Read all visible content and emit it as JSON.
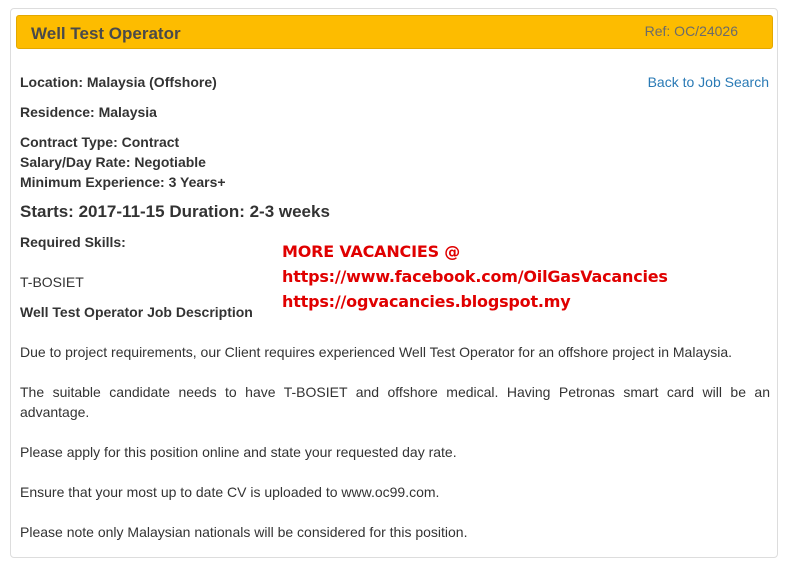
{
  "header": {
    "title": "Well Test Operator",
    "ref": "Ref: OC/24026"
  },
  "details": {
    "location": "Location: Malaysia (Offshore)",
    "residence": "Residence: Malaysia",
    "contract_type": "Contract Type: Contract",
    "salary": "Salary/Day Rate: Negotiable",
    "experience": "Minimum Experience: 3 Years+",
    "starts": "Starts: 2017-11-15 Duration: 2-3 weeks",
    "required_skills_label": "Required Skills:",
    "skill": "T-BOSIET",
    "description_heading": "Well Test Operator Job Description"
  },
  "links": {
    "back_to_search": "Back to Job Search"
  },
  "promo": {
    "line1": "MORE VACANCIES @",
    "line2": "https://www.facebook.com/OilGasVacancies",
    "line3": "https://ogvacancies.blogspot.my"
  },
  "description": [
    "Due to project requirements, our Client requires experienced Well Test Operator for an offshore project in Malaysia.",
    "The suitable candidate needs to have T-BOSIET and offshore medical. Having Petronas smart card will be an advantage.",
    "Please apply for this position online and state your requested day rate.",
    "Ensure that your most up to date CV is uploaded to www.oc99.com.",
    "Please note only Malaysian nationals will be considered for this position."
  ],
  "colors": {
    "header_bg": "#fdbc00",
    "link": "#2a7ab5",
    "promo_text": "#e00000"
  }
}
